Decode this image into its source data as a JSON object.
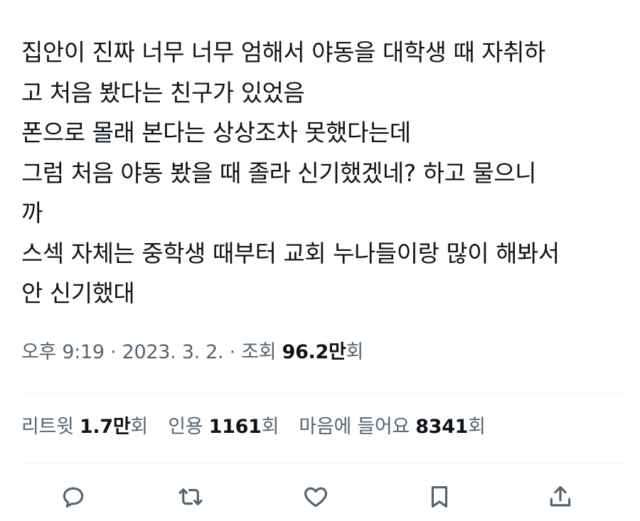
{
  "tweet": {
    "lines": [
      "집안이 진짜 너무 너무 엄해서 야동을 대학생 때 자취하",
      "고 처음 봤다는 친구가 있었음",
      "폰으로 몰래 본다는 상상조차 못했다는데",
      "그럼 처음 야동 봤을 때  졸라 신기했겠네? 하고 물으니",
      "까",
      "스섹 자체는 중학생 때부터 교회 누나들이랑 많이 해봐서",
      "안 신기했대"
    ]
  },
  "meta": {
    "time": "오후 9:19",
    "sep1": " · ",
    "date": "2023. 3. 2.",
    "sep2": " · ",
    "views_label": "조회 ",
    "views_value": "96.2만",
    "views_suffix": "회"
  },
  "stats": {
    "retweets_label": "리트윗 ",
    "retweets_value": "1.7만",
    "retweets_suffix": "회",
    "quotes_label": "인용 ",
    "quotes_value": "1161",
    "quotes_suffix": "회",
    "likes_label": "마음에 들어요 ",
    "likes_value": "8341",
    "likes_suffix": "회"
  },
  "actions": {
    "reply_icon": "reply-icon",
    "retweet_icon": "retweet-icon",
    "like_icon": "heart-icon",
    "bookmark_icon": "bookmark-icon",
    "share_icon": "share-icon"
  },
  "colors": {
    "text": "#0f1419",
    "secondary": "#536471",
    "divider": "#eff3f4"
  }
}
